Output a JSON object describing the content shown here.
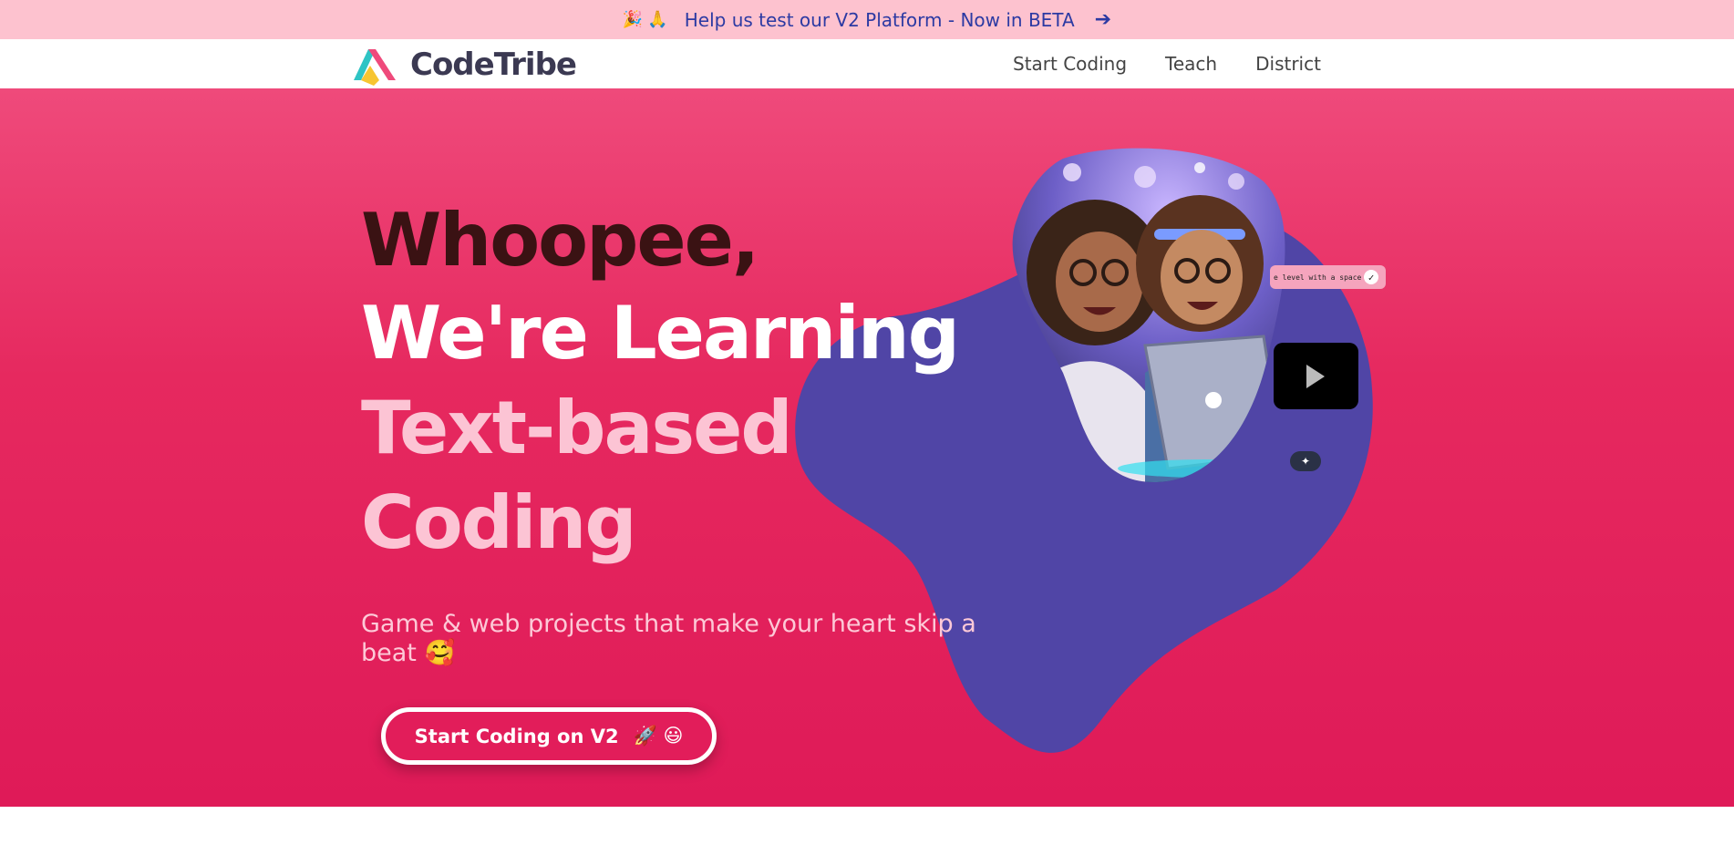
{
  "banner": {
    "emoji": "🎉 🙏",
    "text": "Help us test our V2 Platform - Now in BETA",
    "arrow": "➔"
  },
  "nav": {
    "logo_text": "CodeTribe",
    "links": [
      "Start Coding",
      "Teach",
      "District"
    ]
  },
  "hero": {
    "line1": "Whoopee,",
    "line2": "We're Learning",
    "line3": "Text-based",
    "line4": "Coding",
    "subtitle": "Game & web projects that make your heart skip a beat 🥰",
    "cta_label": "Start Coding on V2",
    "cta_emoji": "🚀 😃"
  },
  "widgets": {
    "chip_text": "e level with a space",
    "check_icon": "check-icon",
    "play_icon": "play-icon",
    "wand_icon": "magic-wand-icon"
  },
  "colors": {
    "banner_bg": "#fdc2cf",
    "banner_text": "#2c3aa3",
    "hero_pink": "#e21d5a",
    "blob_purple": "#5045a6",
    "headline_dark": "#3a1213",
    "headline_light": "#fcc4d4"
  }
}
